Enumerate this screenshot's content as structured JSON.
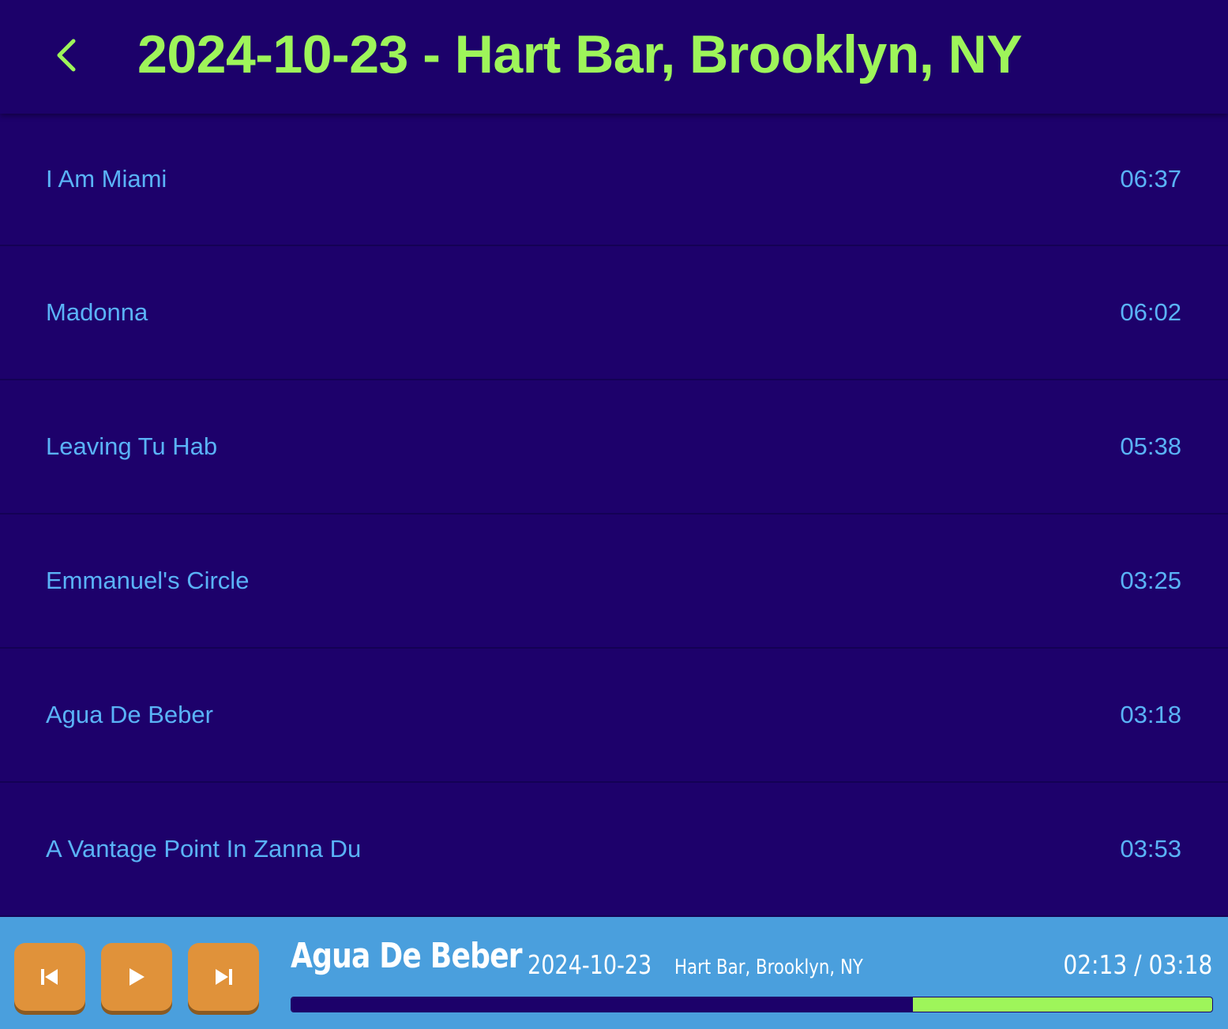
{
  "header": {
    "title": "2024-10-23 - Hart Bar, Brooklyn, NY",
    "back_icon": "chevron-left-icon"
  },
  "tracks": [
    {
      "title": "I Am Miami",
      "duration": "06:37"
    },
    {
      "title": "Madonna",
      "duration": "06:02"
    },
    {
      "title": "Leaving Tu Hab",
      "duration": "05:38"
    },
    {
      "title": "Emmanuel's Circle",
      "duration": "03:25"
    },
    {
      "title": "Agua De Beber",
      "duration": "03:18"
    },
    {
      "title": "A Vantage Point In Zanna Du",
      "duration": "03:53"
    }
  ],
  "player": {
    "now_playing_title": "Agua De Beber",
    "now_playing_date": "2024-10-23",
    "now_playing_venue": "Hart Bar, Brooklyn, NY",
    "time_display": "02:13 / 03:18",
    "progress_fraction": 0.675,
    "controls": [
      "skip-back-icon",
      "play-icon",
      "skip-forward-icon"
    ]
  },
  "colors": {
    "background": "#1d016b",
    "accent_green": "#9ef55a",
    "track_text": "#5ab3f7",
    "player_bar": "#4a9fdd",
    "button_orange": "#e0923a"
  }
}
